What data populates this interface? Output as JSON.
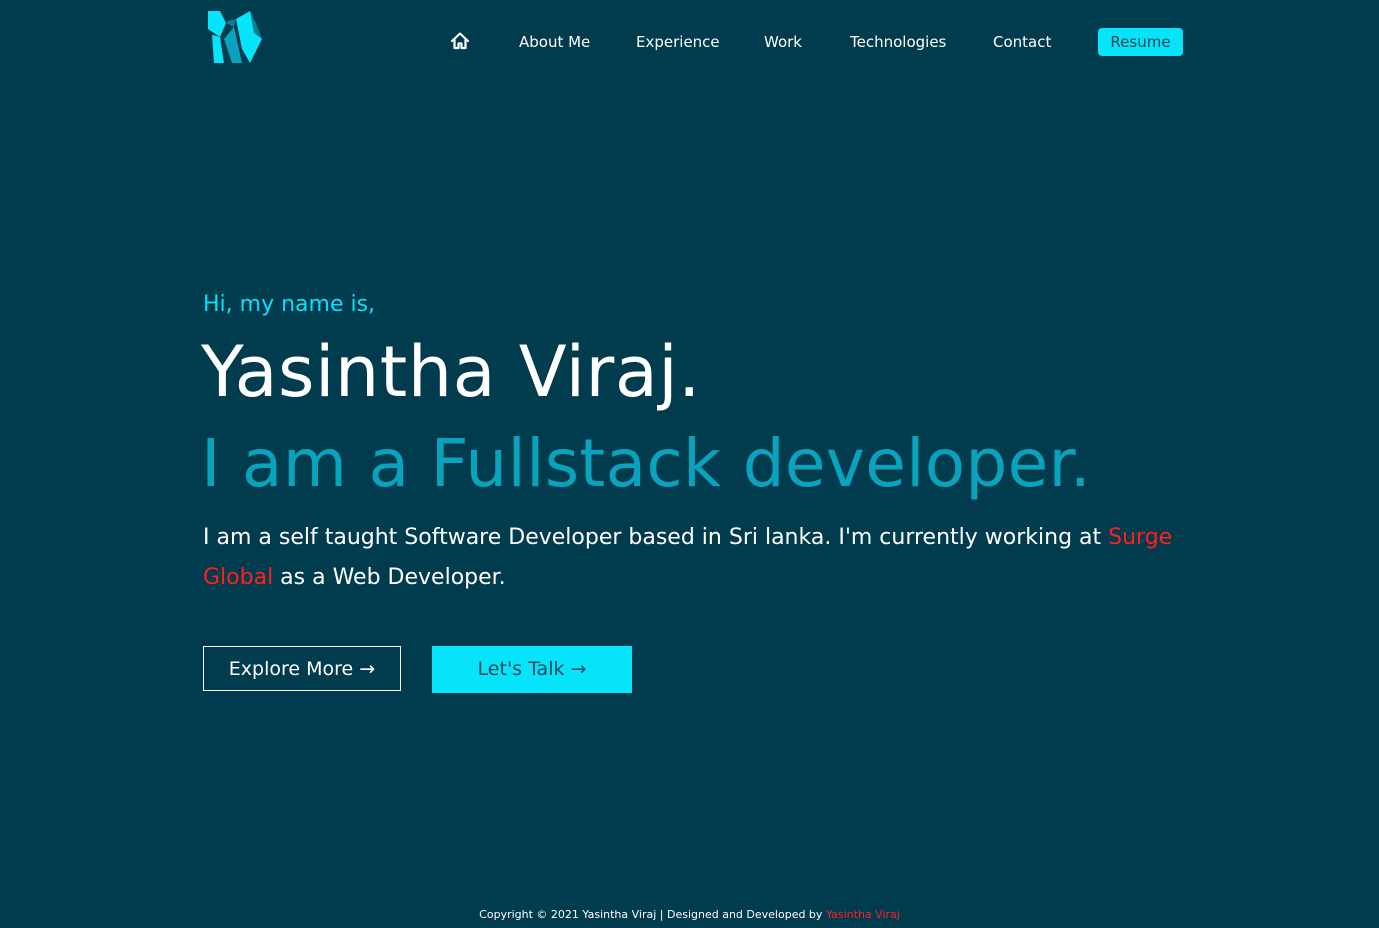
{
  "nav": {
    "home_icon": "home-icon",
    "items": [
      "About Me",
      "Experience",
      "Work",
      "Technologies",
      "Contact"
    ],
    "resume_label": "Resume"
  },
  "logo": {
    "icon": "logo-mark",
    "colors": [
      "#07e3f9",
      "#0aa3bd",
      "#0b7e96"
    ]
  },
  "hero": {
    "greeting": "Hi, my name is,",
    "name": "Yasintha Viraj.",
    "role": "I am a Fullstack developer.",
    "bio_before": "I am a self taught Software Developer based in Sri lanka. I'm currently working at ",
    "bio_company": "Surge Global",
    "bio_after": " as a Web Developer.",
    "explore_label": "Explore More →",
    "talk_label": "Let's Talk →"
  },
  "footer": {
    "copyright": "Copyright © 2021 Yasintha Viraj | Designed and Developed by ",
    "author": "Yasintha Viraj"
  },
  "colors": {
    "background": "#013b4e",
    "accent": "#07e3f9",
    "accent_dark": "#0aa3bd",
    "highlight": "#ff1f1f",
    "text": "#ffffff"
  }
}
